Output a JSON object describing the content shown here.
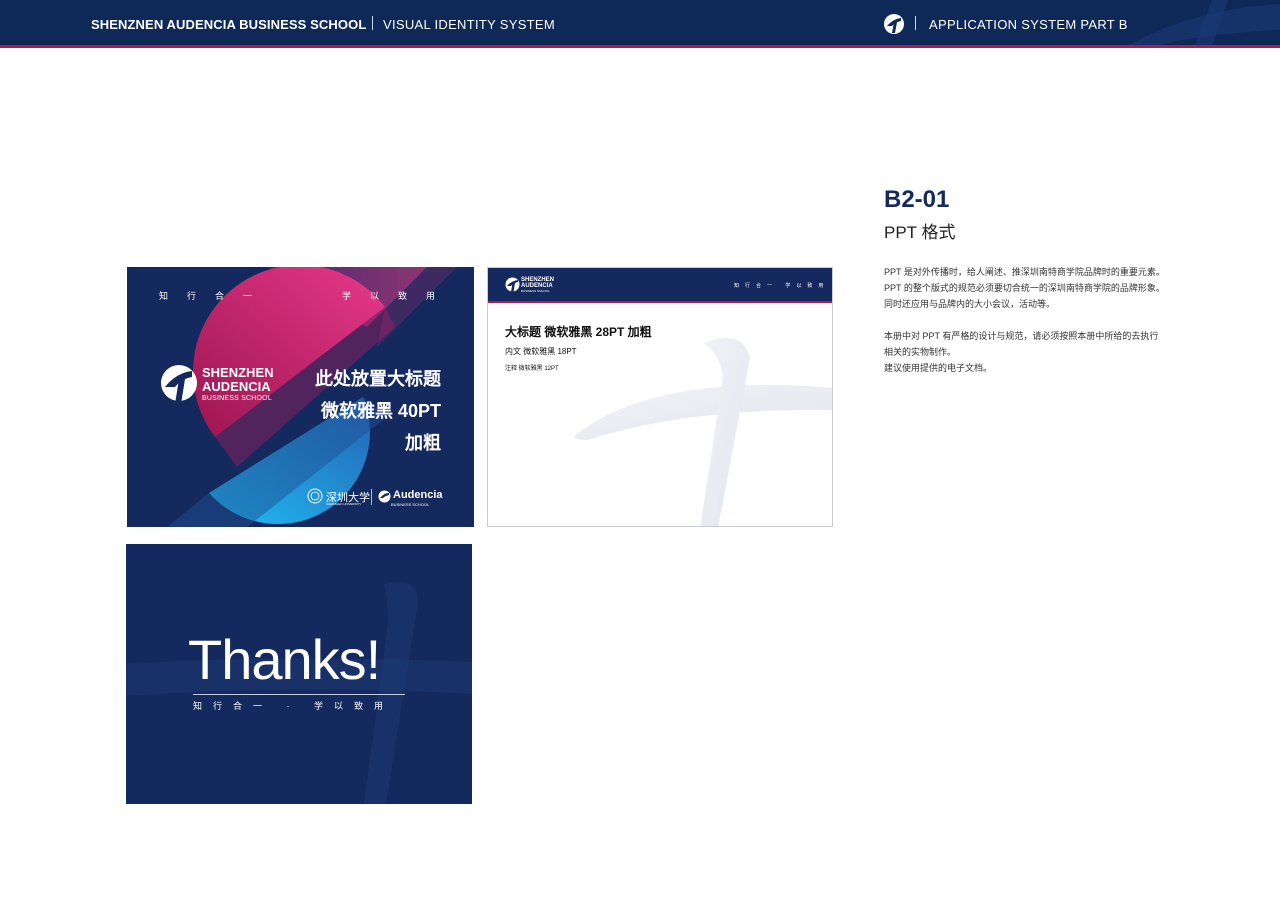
{
  "header": {
    "school": "SHENZNEN AUDENCIA BUSINESS SCHOOL",
    "system": "VISUAL IDENTITY SYSTEM",
    "part": "APPLICATION SYSTEM PART B"
  },
  "slide_cover": {
    "motto_left": "知行合一",
    "motto_right": "学以致用",
    "brand_line1": "SHENZHEN",
    "brand_line2": "AUDENCIA",
    "brand_sub": "BUSINESS SCHOOL",
    "title_line1": "此处放置大标题",
    "title_line2": "微软雅黑 40PT",
    "title_line3": "加粗",
    "partner1": "深圳大学",
    "partner1_en": "SHENZHEN UNIVERSITY",
    "partner2": "Audencia",
    "partner2_sub": "BUSINESS SCHOOL"
  },
  "slide_content": {
    "brand_line1": "SHENZHEN",
    "brand_line2": "AUDENCIA",
    "brand_sub": "BUSINESS SCHOOL",
    "motto": "知行合一 学以致用",
    "title": "大标题 微软雅黑 28PT 加粗",
    "body": "内文 微软雅黑 18PT",
    "note": "注释 微软雅黑 12PT"
  },
  "slide_end": {
    "thanks": "Thanks!",
    "motto": "知行合一 · 学以致用"
  },
  "info": {
    "code": "B2-01",
    "title": "PPT 格式",
    "para1_line1": "PPT 是对外传播时，给人阐述、推深圳南特商学院品牌时的重要元素。",
    "para1_line2": "PPT 的整个版式的规范必须要切合统一的深圳南特商学院的品牌形象。",
    "para1_line3": "同时还应用与品牌内的大小会议，活动等。",
    "para2_line1": "本册中对 PPT 有严格的设计与规范，请必须按照本册中所给的去执行",
    "para2_line2": "相关的实物制作。",
    "para2_line3": "建议使用提供的电子文档。"
  },
  "colors": {
    "navy": "#14295e",
    "accent_red": "#b3184e",
    "magenta": "#e0347f",
    "cyan": "#1bb5f0"
  },
  "icons": [
    "brand-logo-icon",
    "szu-seal-icon",
    "audencia-logo-icon"
  ]
}
